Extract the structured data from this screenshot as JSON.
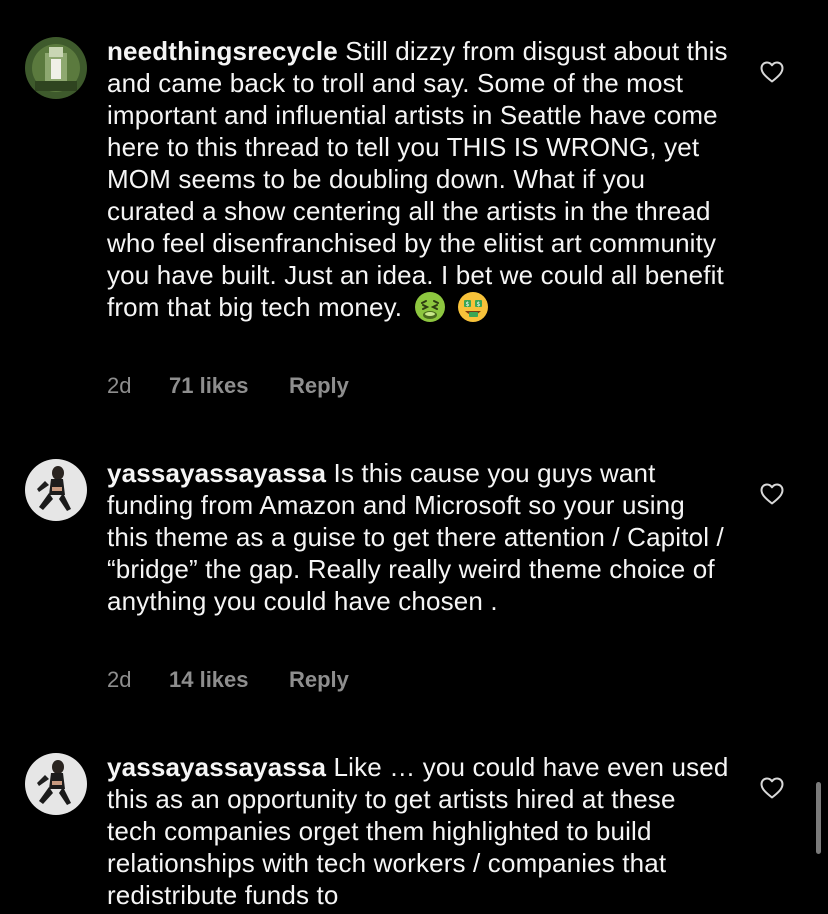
{
  "comments": [
    {
      "username": "needthingsrecycle",
      "text": "Still dizzy from disgust about this and came back to troll and say. Some of the most important and influential artists in Seattle have come here to this thread to tell you THIS IS WRONG, yet MOM seems to be doubling down.  What if you curated a show centering all the artists in the thread who feel disenfranchised by the elitist art community you have built.  Just an idea.  I bet we could all benefit from that big tech money.",
      "emojis": [
        "nauseated-face",
        "money-mouth-face"
      ],
      "age": "2d",
      "likes": "71 likes",
      "reply": "Reply",
      "avatar": "avatar-needthingsrecycle"
    },
    {
      "username": "yassayassayassa",
      "text": "Is this cause you guys want funding from Amazon and Microsoft so your using this theme as a guise to get there attention / Capitol / “bridge” the gap. Really really weird theme choice of anything you could have chosen .",
      "age": "2d",
      "likes": "14 likes",
      "reply": "Reply",
      "avatar": "avatar-yassayassayassa"
    },
    {
      "username": "yassayassayassa",
      "text": "Like … you could have even used this as an opportunity to get artists hired at these tech companies orget them highlighted to build relationships with tech workers / companies that redistribute funds to",
      "avatar": "avatar-yassayassayassa"
    }
  ],
  "colors": {
    "background": "#000000",
    "text": "#f5f5f5",
    "meta": "#8e8e8e"
  }
}
